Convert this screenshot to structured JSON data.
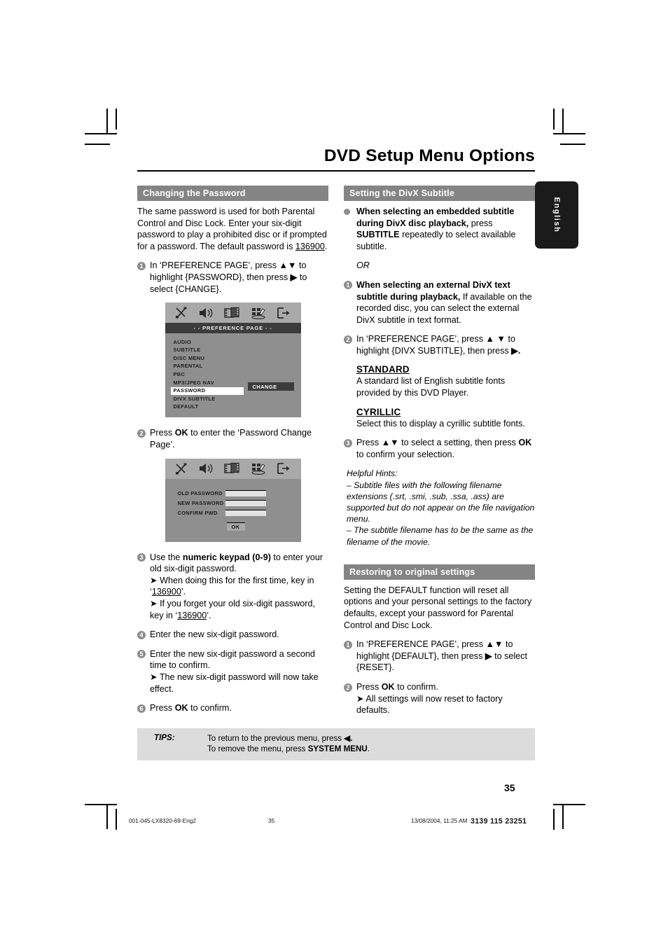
{
  "header": {
    "title": "DVD Setup Menu Options",
    "language_tab": "English"
  },
  "left_column": {
    "section_title": "Changing the Password",
    "intro_1": "The same password is used for both Parental Control and Disc Lock.  Enter your six-digit password to play a prohibited disc or if prompted for a password.  The default password is ",
    "intro_default_password": "136900",
    "intro_1_end": ".",
    "step1_num": "1",
    "step1_a": "In ‘PREFERENCE PAGE’, press ",
    "step1_arrows": "▲▼",
    "step1_b": " to highlight {PASSWORD}, then press ",
    "step1_right": "▶",
    "step1_c": " to select {CHANGE}.",
    "step2_num": "2",
    "step2_a": "Press ",
    "step2_ok": "OK",
    "step2_b": " to enter the ‘Password Change Page’.",
    "step3_num": "3",
    "step3_a": "Use the ",
    "step3_bold": "numeric keypad (0-9)",
    "step3_b": " to enter your old six-digit password.",
    "step3_sub1_a": "When doing this for the first time, key in ‘",
    "step3_sub1_code": "136900",
    "step3_sub1_b": "’.",
    "step3_sub2_a": "If you forget your old six-digit password, key in ‘",
    "step3_sub2_code": "136900",
    "step3_sub2_b": "’.",
    "step4_num": "4",
    "step4_text": "Enter the new six-digit password.",
    "step5_num": "5",
    "step5_text": "Enter the new six-digit password a second time to confirm.",
    "step5_sub": "The new six-digit password will now take effect.",
    "step6_num": "6",
    "step6_a": "Press ",
    "step6_ok": "OK",
    "step6_b": " to confirm."
  },
  "osd_preference": {
    "title": "- -  PREFERENCE  PAGE  - -",
    "items": [
      "AUDIO",
      "SUBTITLE",
      "DISC MENU",
      "PARENTAL",
      "PBC",
      "MP3/JPEG NAV",
      "PASSWORD",
      "DIVX SUBTITLE",
      "DEFAULT"
    ],
    "selected_item": "PASSWORD",
    "selected_value": "CHANGE",
    "icons": [
      "general-setup-icon",
      "audio-setup-icon",
      "video-setup-icon",
      "preference-setup-icon",
      "exit-setup-icon"
    ]
  },
  "osd_password_change": {
    "rows": [
      {
        "label": "OLD PASSWORD",
        "value": ""
      },
      {
        "label": "NEW PASSWORD",
        "value": ""
      },
      {
        "label": "CONFIRM PWD",
        "value": ""
      }
    ],
    "ok_label": "OK",
    "icons": [
      "general-setup-icon",
      "audio-setup-icon",
      "video-setup-icon",
      "preference-setup-icon",
      "exit-setup-icon"
    ]
  },
  "right_column": {
    "section_title": "Setting the DivX Subtitle",
    "bullet1_bold": "When selecting an embedded subtitle during DivX disc playback,",
    "bullet1_a": " press ",
    "bullet1_key": "SUBTITLE",
    "bullet1_b": " repeatedly to select available subtitle.",
    "or_text": "OR",
    "step1_num": "1",
    "step1_bold": "When selecting an external DivX text subtitle during playback,",
    "step1_text": "If available on the recorded disc, you can select the external DivX subtitle in text format.",
    "step2_num": "2",
    "step2_a": "In ‘PREFERENCE PAGE’, press ",
    "step2_arrows": "▲ ▼",
    "step2_b": " to highlight {DIVX SUBTITLE}, then press ",
    "step2_right": "▶.",
    "standard_head": "STANDARD",
    "standard_text": "A standard list of English subtitle fonts provided by this DVD Player.",
    "cyrillic_head": "CYRILLIC",
    "cyrillic_text": "Select this to display a cyrillic subtitle fonts.",
    "step3_num": "3",
    "step3_a": "Press ",
    "step3_arrows": "▲▼",
    "step3_b": " to select a setting, then press ",
    "step3_ok": "OK",
    "step3_c": " to confirm your selection.",
    "hints_title": "Helpful Hints:",
    "hint1": "– Subtitle files with the following filename extensions (.srt, .smi, .sub, .ssa, .ass) are supported but do not appear on the file navigation menu.",
    "hint2": "– The subtitle filename has to be the same as the filename of the movie.",
    "restore_title": "Restoring to original settings",
    "restore_intro": "Setting the DEFAULT function will reset all options and your personal settings to the factory defaults, except your password for Parental Control and Disc Lock.",
    "r_step1_num": "1",
    "r_step1_a": "In ‘PREFERENCE PAGE’, press ",
    "r_step1_arrows": "▲▼",
    "r_step1_b": " to highlight {DEFAULT}, then press ",
    "r_step1_right": "▶",
    "r_step1_c": " to select {RESET}.",
    "r_step2_num": "2",
    "r_step2_a": "Press ",
    "r_step2_ok": "OK",
    "r_step2_b": " to confirm.",
    "r_step2_sub": "All settings will now reset to factory defaults."
  },
  "tips": {
    "label": "TIPS:",
    "line1_a": "To return to the previous menu, press ",
    "line1_arrow": "◀.",
    "line2_a": "To remove the menu, press ",
    "line2_bold": "SYSTEM MENU",
    "line2_b": "."
  },
  "page_number": "35",
  "footer": {
    "document_id": "001-045-LX8320-69-Eng2",
    "page": "35",
    "timestamp": "13/08/2004, 11:25 AM",
    "code": "3139 115 23251"
  }
}
